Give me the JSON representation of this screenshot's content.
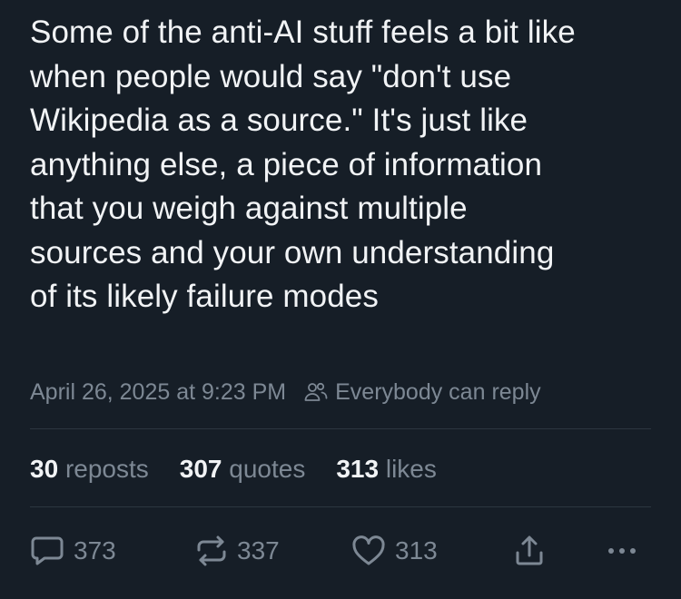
{
  "post": {
    "text_lines": [
      "Some of the anti-AI stuff feels a bit like",
      "when people would say \"don't use",
      "Wikipedia as a source.\" It's just like",
      "anything else, a piece of information",
      "that you weigh against multiple",
      "sources and your own understanding",
      "of its likely failure modes"
    ],
    "timestamp": "April 26, 2025 at 9:23 PM",
    "reply_setting": "Everybody can reply"
  },
  "stats": {
    "reposts": {
      "count": "30",
      "label": "reposts"
    },
    "quotes": {
      "count": "307",
      "label": "quotes"
    },
    "likes": {
      "count": "313",
      "label": "likes"
    }
  },
  "actions": {
    "reply": {
      "icon": "speech-bubble-icon",
      "count": "373"
    },
    "repost": {
      "icon": "repost-arrows-icon",
      "count": "337"
    },
    "like": {
      "icon": "heart-icon",
      "count": "313"
    },
    "share": {
      "icon": "share-upload-icon"
    },
    "more": {
      "icon": "more-dots-icon"
    }
  },
  "colors": {
    "background": "#161e27",
    "text_primary": "#f1f3f5",
    "text_secondary": "#7d8894",
    "divider": "#2c3640"
  }
}
